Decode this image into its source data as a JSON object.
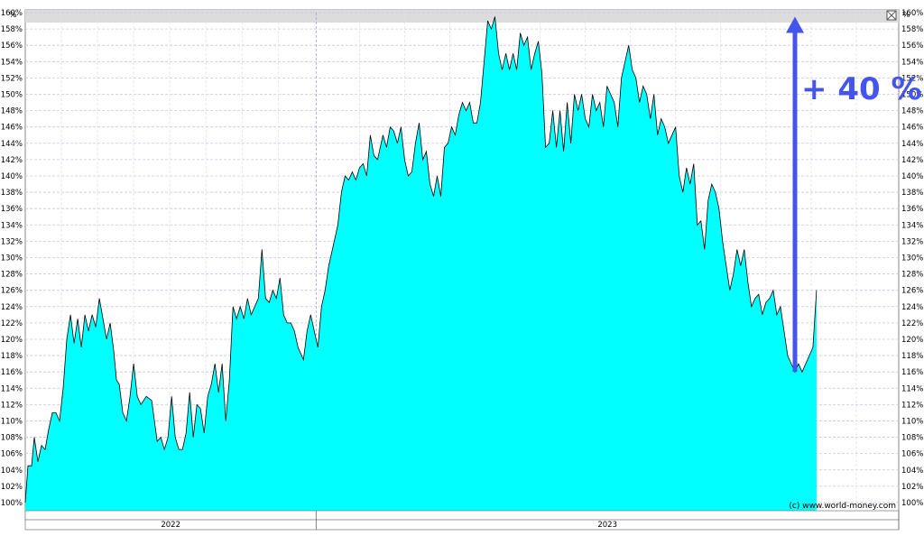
{
  "chart_data": {
    "type": "area",
    "title": "",
    "xlabel": "",
    "ylabel": "%",
    "ylim": [
      99,
      160
    ],
    "yticks": [
      100,
      102,
      104,
      106,
      108,
      110,
      112,
      114,
      116,
      118,
      120,
      122,
      124,
      126,
      128,
      130,
      132,
      134,
      136,
      138,
      140,
      142,
      144,
      146,
      148,
      150,
      152,
      154,
      156,
      158,
      160
    ],
    "ytick_suffix": "%",
    "unit_label": "%",
    "x_periods": [
      {
        "label": "2022",
        "start": 0,
        "end": 322
      },
      {
        "label": "2023",
        "start": 322,
        "end": 967
      }
    ],
    "xlim": [
      0,
      967
    ],
    "grid": true,
    "fill_color": "#00FFFF",
    "line_color": "#000000",
    "annotation": {
      "text": "+ 40 %",
      "color": "#4455EE",
      "from_value": 116,
      "to_value": 159.5
    },
    "credit": "(c) www.world-money.com",
    "series": [
      {
        "values": [
          [
            0,
            100
          ],
          [
            3,
            104.5
          ],
          [
            7,
            104.5
          ],
          [
            10,
            108
          ],
          [
            14,
            105
          ],
          [
            18,
            107
          ],
          [
            22,
            106.5
          ],
          [
            26,
            109
          ],
          [
            30,
            111
          ],
          [
            34,
            111
          ],
          [
            38,
            110
          ],
          [
            42,
            114
          ],
          [
            46,
            120
          ],
          [
            50,
            123
          ],
          [
            54,
            119.5
          ],
          [
            58,
            122.5
          ],
          [
            62,
            119
          ],
          [
            66,
            123
          ],
          [
            70,
            121
          ],
          [
            74,
            123
          ],
          [
            78,
            121.5
          ],
          [
            82,
            125
          ],
          [
            86,
            122.5
          ],
          [
            90,
            120
          ],
          [
            94,
            122
          ],
          [
            98,
            118.5
          ],
          [
            101,
            115
          ],
          [
            104,
            114.5
          ],
          [
            108,
            111
          ],
          [
            112,
            110
          ],
          [
            116,
            113
          ],
          [
            120,
            117
          ],
          [
            124,
            113
          ],
          [
            128,
            112
          ],
          [
            134,
            113
          ],
          [
            140,
            112.5
          ],
          [
            146,
            107.5
          ],
          [
            150,
            108
          ],
          [
            154,
            106.5
          ],
          [
            158,
            108
          ],
          [
            162,
            113
          ],
          [
            166,
            108
          ],
          [
            170,
            106.5
          ],
          [
            174,
            106.5
          ],
          [
            178,
            108.5
          ],
          [
            182,
            113.5
          ],
          [
            186,
            108
          ],
          [
            190,
            112
          ],
          [
            194,
            111.5
          ],
          [
            198,
            108.5
          ],
          [
            202,
            113
          ],
          [
            206,
            114.5
          ],
          [
            210,
            117
          ],
          [
            214,
            113.5
          ],
          [
            218,
            117
          ],
          [
            222,
            110
          ],
          [
            226,
            115
          ],
          [
            230,
            124
          ],
          [
            234,
            122.5
          ],
          [
            238,
            124
          ],
          [
            242,
            122.5
          ],
          [
            246,
            125
          ],
          [
            250,
            123
          ],
          [
            254,
            124
          ],
          [
            258,
            125
          ],
          [
            262,
            131
          ],
          [
            266,
            125
          ],
          [
            270,
            124.5
          ],
          [
            274,
            126
          ],
          [
            278,
            125
          ],
          [
            282,
            127.5
          ],
          [
            286,
            123
          ],
          [
            290,
            122
          ],
          [
            294,
            122
          ],
          [
            298,
            121
          ],
          [
            302,
            119
          ],
          [
            308,
            117.5
          ],
          [
            312,
            121
          ],
          [
            316,
            123
          ],
          [
            320,
            121
          ],
          [
            324,
            119
          ],
          [
            328,
            124
          ],
          [
            332,
            126
          ],
          [
            336,
            129
          ],
          [
            340,
            131
          ],
          [
            346,
            134
          ],
          [
            350,
            138
          ],
          [
            354,
            140
          ],
          [
            358,
            139.5
          ],
          [
            362,
            140.5
          ],
          [
            366,
            139.5
          ],
          [
            370,
            141
          ],
          [
            374,
            141.5
          ],
          [
            378,
            140
          ],
          [
            382,
            145
          ],
          [
            386,
            142.5
          ],
          [
            390,
            142
          ],
          [
            396,
            145
          ],
          [
            400,
            143.5
          ],
          [
            404,
            146
          ],
          [
            408,
            145.5
          ],
          [
            412,
            144
          ],
          [
            416,
            146
          ],
          [
            420,
            142
          ],
          [
            424,
            140
          ],
          [
            428,
            140.5
          ],
          [
            432,
            144
          ],
          [
            436,
            146.5
          ],
          [
            440,
            142
          ],
          [
            444,
            143
          ],
          [
            448,
            139
          ],
          [
            452,
            137.5
          ],
          [
            456,
            140
          ],
          [
            460,
            137.5
          ],
          [
            464,
            143.5
          ],
          [
            468,
            144
          ],
          [
            472,
            146
          ],
          [
            476,
            145
          ],
          [
            480,
            147.5
          ],
          [
            484,
            149
          ],
          [
            488,
            148
          ],
          [
            492,
            149
          ],
          [
            496,
            146.5
          ],
          [
            500,
            146.5
          ],
          [
            504,
            149
          ],
          [
            508,
            154
          ],
          [
            512,
            159
          ],
          [
            516,
            158
          ],
          [
            520,
            159.5
          ],
          [
            524,
            155
          ],
          [
            528,
            153
          ],
          [
            532,
            155
          ],
          [
            536,
            153
          ],
          [
            540,
            155
          ],
          [
            544,
            153
          ],
          [
            548,
            157.5
          ],
          [
            552,
            156
          ],
          [
            556,
            157
          ],
          [
            560,
            153
          ],
          [
            564,
            155
          ],
          [
            568,
            156.5
          ],
          [
            572,
            152.5
          ],
          [
            576,
            143.5
          ],
          [
            580,
            144
          ],
          [
            584,
            148
          ],
          [
            588,
            143.5
          ],
          [
            592,
            148
          ],
          [
            596,
            143
          ],
          [
            600,
            149
          ],
          [
            604,
            144
          ],
          [
            608,
            150
          ],
          [
            612,
            148
          ],
          [
            616,
            150
          ],
          [
            620,
            147
          ],
          [
            624,
            146
          ],
          [
            628,
            150
          ],
          [
            632,
            148
          ],
          [
            636,
            149
          ],
          [
            640,
            146
          ],
          [
            644,
            151
          ],
          [
            648,
            150
          ],
          [
            652,
            149
          ],
          [
            656,
            146
          ],
          [
            660,
            152
          ],
          [
            664,
            154
          ],
          [
            668,
            156
          ],
          [
            672,
            153
          ],
          [
            676,
            152
          ],
          [
            680,
            149
          ],
          [
            684,
            151
          ],
          [
            688,
            150
          ],
          [
            692,
            147
          ],
          [
            696,
            150
          ],
          [
            700,
            145
          ],
          [
            704,
            147
          ],
          [
            708,
            146
          ],
          [
            712,
            144
          ],
          [
            716,
            145
          ],
          [
            720,
            146
          ],
          [
            724,
            140
          ],
          [
            728,
            138
          ],
          [
            732,
            141
          ],
          [
            736,
            139
          ],
          [
            740,
            141.5
          ],
          [
            744,
            134
          ],
          [
            748,
            134.5
          ],
          [
            752,
            131
          ],
          [
            756,
            137
          ],
          [
            760,
            139
          ],
          [
            764,
            138
          ],
          [
            768,
            136
          ],
          [
            772,
            132
          ],
          [
            776,
            129
          ],
          [
            780,
            126
          ],
          [
            784,
            128
          ],
          [
            788,
            131
          ],
          [
            792,
            129
          ],
          [
            796,
            131
          ],
          [
            800,
            127
          ],
          [
            804,
            124
          ],
          [
            808,
            125
          ],
          [
            812,
            125.5
          ],
          [
            816,
            123
          ],
          [
            820,
            124.5
          ],
          [
            824,
            125
          ],
          [
            828,
            126
          ],
          [
            832,
            123
          ],
          [
            836,
            124
          ],
          [
            840,
            121
          ],
          [
            844,
            118
          ],
          [
            848,
            117
          ],
          [
            852,
            116
          ],
          [
            856,
            117
          ],
          [
            860,
            116
          ],
          [
            864,
            117
          ],
          [
            868,
            118
          ],
          [
            872,
            119
          ],
          [
            876,
            126
          ]
        ]
      }
    ]
  }
}
